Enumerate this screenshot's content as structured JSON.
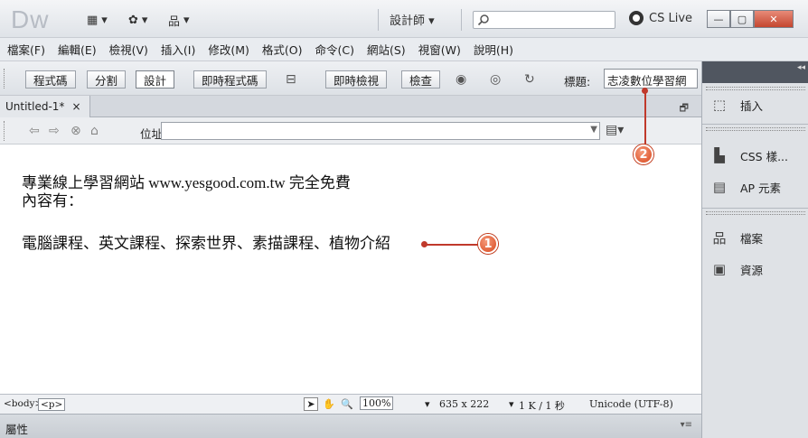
{
  "app": {
    "logo": "Dw",
    "workspace": "設計師 ▾",
    "cslive": "CS Live",
    "search_placeholder": ""
  },
  "window_controls": {
    "minimize": "—",
    "maximize": "▢",
    "close": "✕"
  },
  "menu": [
    "檔案(F)",
    "編輯(E)",
    "檢視(V)",
    "插入(I)",
    "修改(M)",
    "格式(O)",
    "命令(C)",
    "網站(S)",
    "視窗(W)",
    "說明(H)"
  ],
  "toolbar": {
    "code": "程式碼",
    "split": "分割",
    "design": "設計",
    "live_code": "即時程式碼",
    "live_view": "即時檢視",
    "inspect": "檢查",
    "title_label": "標題:",
    "title_value": "志凌數位學習網"
  },
  "tab": {
    "name": "Untitled-1*",
    "close": "×"
  },
  "address": {
    "label": "位址:",
    "value": ""
  },
  "document": {
    "line1": "專業線上學習網站 www.yesgood.com.tw 完全免費",
    "line2": "內容有：",
    "line3": "電腦課程、英文課程、探索世界、素描課程、植物介紹"
  },
  "callouts": {
    "one": "1",
    "two": "2"
  },
  "status": {
    "tag_body": "<body>",
    "tag_p": "<p>",
    "zoom": "100%",
    "dimensions": "635 x 222",
    "size_time": "1 K / 1 秒",
    "encoding": "Unicode (UTF-8)"
  },
  "properties": {
    "label": "屬性"
  },
  "panel": {
    "insert": "插入",
    "css": "CSS 樣...",
    "ap": "AP 元素",
    "files": "檔案",
    "assets": "資源"
  }
}
